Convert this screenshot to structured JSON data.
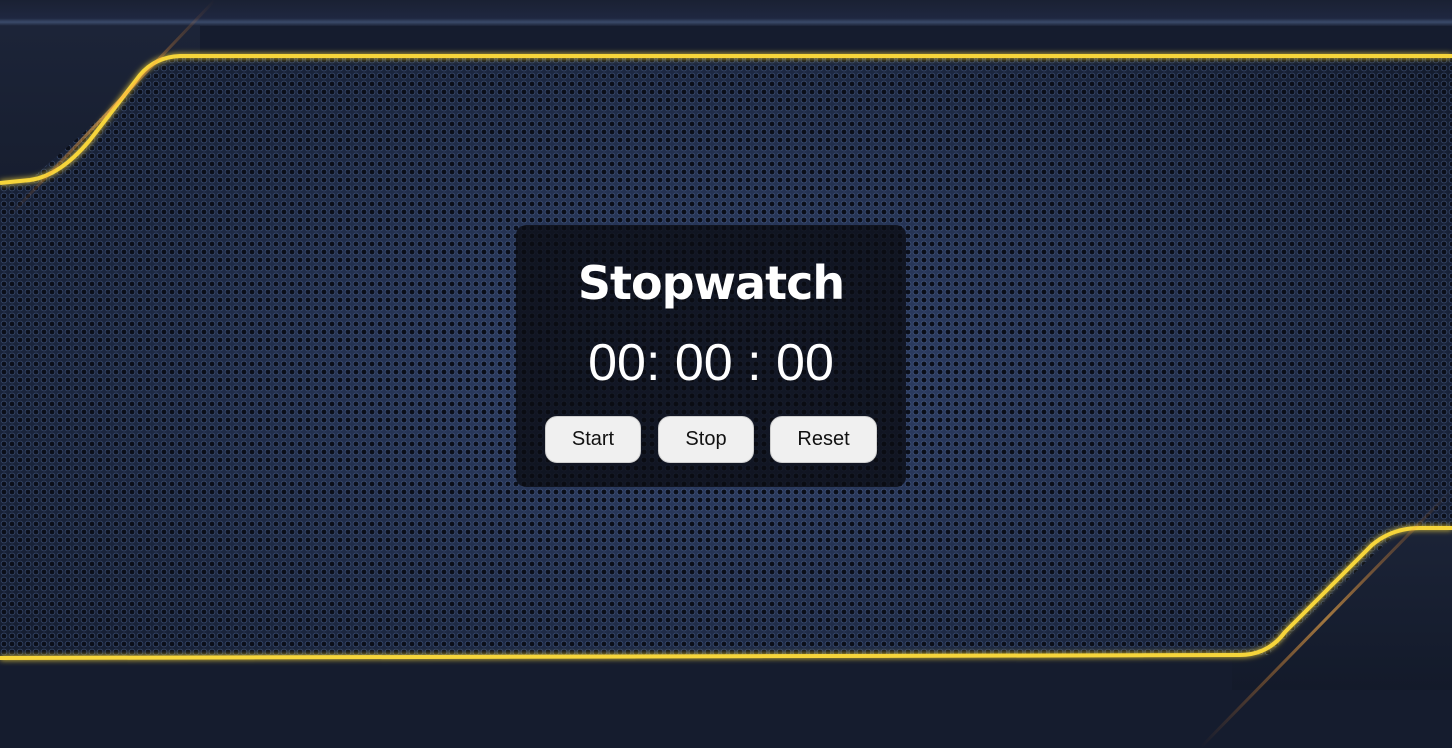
{
  "stopwatch": {
    "title": "Stopwatch",
    "time_display": "00: 00 : 00",
    "buttons": {
      "start_label": "Start",
      "stop_label": "Stop",
      "reset_label": "Reset"
    }
  },
  "colors": {
    "accent_gold": "#f6d53a",
    "card_background": "#0a0c12",
    "button_background": "#f0f0f0",
    "text": "#ffffff"
  }
}
